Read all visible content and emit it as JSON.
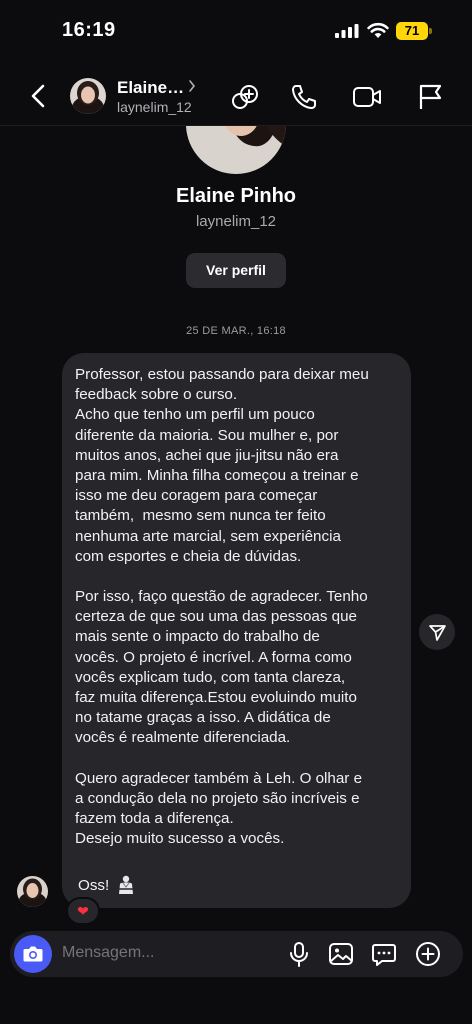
{
  "status": {
    "time": "16:19",
    "battery": "71"
  },
  "header": {
    "name": "Elaine…",
    "username": "laynelim_12"
  },
  "profile": {
    "name": "Elaine Pinho",
    "username": "laynelim_12",
    "view_profile_label": "Ver perfil"
  },
  "timestamp": "25 DE MAR., 16:18",
  "message": {
    "paragraphs": [
      "Professor, estou passando para deixar meu\nfeedback sobre o curso.\nAcho que tenho um perfil um pouco\ndiferente da maioria. Sou mulher e, por\nmuitos anos, achei que jiu-jitsu não era\npara mim. Minha filha começou a treinar e\nisso me deu coragem para começar\ntambém,  mesmo sem nunca ter feito\nnenhuma arte marcial, sem experiência\ncom esportes e cheia de dúvidas.",
      "Por isso, faço questão de agradecer. Tenho\ncerteza de que sou uma das pessoas que\nmais sente o impacto do trabalho de\nvocês. O projeto é incrível. A forma como\nvocês explicam tudo, com tanta clareza,\nfaz muita diferença.Estou evoluindo muito\nno tatame graças a isso. A didática de\nvocês é realmente diferenciada.",
      "Quero agradecer também à Leh. O olhar e\na condução dela no projeto são incríveis e\nfazem toda a diferença.\nDesejo muito sucesso a vocês."
    ],
    "closing": "Oss!",
    "closing_emoji_icon": "martial-arts-uniform-icon",
    "reaction": "❤"
  },
  "composer": {
    "placeholder": "Mensagem..."
  },
  "colors": {
    "background": "#0c0c0e",
    "bubble": "#26262b",
    "camera_button": "#4a5bf5",
    "battery": "#ffd60a",
    "reaction": "#ff3040"
  }
}
